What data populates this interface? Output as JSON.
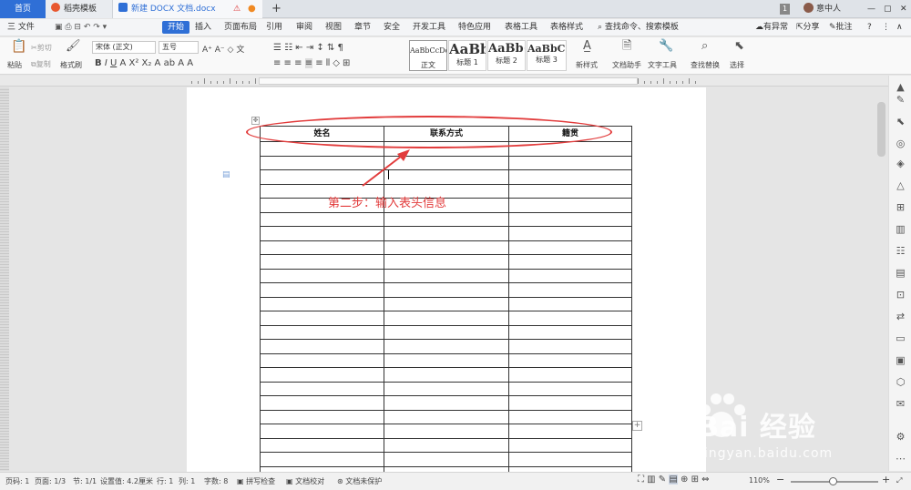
{
  "tabs": {
    "home": "首页",
    "templates": "稻壳模板",
    "document": "新建 DOCX 文档.docx",
    "new_tab": "+"
  },
  "titlebar": {
    "page_badge": "1",
    "user": "意中人"
  },
  "menu": {
    "file": "三 文件",
    "items": [
      "开始",
      "插入",
      "页面布局",
      "引用",
      "审阅",
      "视图",
      "章节",
      "安全",
      "开发工具",
      "特色应用",
      "表格工具",
      "表格样式"
    ],
    "search": "查找命令、搜索模板",
    "issue": "有异常",
    "share": "分享",
    "comment": "批注",
    "help": "?"
  },
  "ribbon": {
    "paste": "粘贴",
    "cut": "剪切",
    "copy": "复制",
    "format_painter": "格式刷",
    "font_name": "宋体 (正文)",
    "font_size": "五号",
    "styles": [
      {
        "preview": "AaBbCcDd",
        "label": "正文"
      },
      {
        "preview": "AaBb",
        "label": "标题 1"
      },
      {
        "preview": "AaBb(",
        "label": "标题 2"
      },
      {
        "preview": "AaBbC(",
        "label": "标题 3"
      }
    ],
    "new_style": "新样式",
    "doc_assistant": "文档助手",
    "text_tools": "文字工具",
    "find_replace": "查找替换",
    "select": "选择"
  },
  "table": {
    "headers": [
      "姓名",
      "联系方式",
      "籍贯"
    ],
    "row_count": 24
  },
  "annotation": {
    "text": "第二步：输入表头信息",
    "color": "#e23c3c"
  },
  "status": {
    "page": "页码: 1",
    "pages": "页面: 1/3",
    "section": "节: 1/1",
    "setting": "设置值: 4.2厘米",
    "row": "行: 1",
    "col": "列: 1",
    "wordcount": "字数: 8",
    "spellcheck": "拼写检查",
    "proofread": "文档校对",
    "protect": "文档未保护",
    "zoom": "110%"
  },
  "watermark": {
    "brand": "Bai 经验",
    "url": "jingyan.baidu.com"
  },
  "colors": {
    "accent": "#2f6fd6",
    "annotation": "#e23c3c"
  }
}
